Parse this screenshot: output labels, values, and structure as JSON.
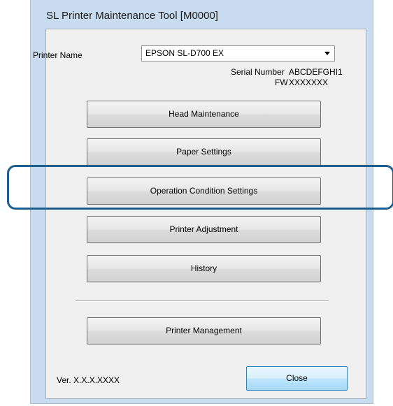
{
  "window": {
    "title": "SL Printer Maintenance Tool [M0000]"
  },
  "printer": {
    "name_label": "Printer Name",
    "selected": "EPSON SL-D700 EX",
    "serial_label": "Serial Number",
    "serial_value": "ABCDEFGHI1",
    "fw_label": "FW",
    "fw_value": "XXXXXXX"
  },
  "buttons": {
    "head_maintenance": "Head Maintenance",
    "paper_settings": "Paper Settings",
    "operation_condition_settings": "Operation Condition Settings",
    "printer_adjustment": "Printer Adjustment",
    "history": "History",
    "printer_management": "Printer Management",
    "close": "Close"
  },
  "footer": {
    "version": "Ver. X.X.X.XXXX"
  },
  "colors": {
    "highlight": "#1f5d8f",
    "window_frame": "#c9dcef",
    "dialog_background": "#f0f0f0"
  }
}
